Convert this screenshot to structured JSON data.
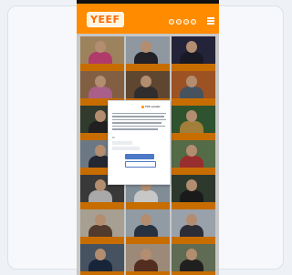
{
  "colors": {
    "brand": "#ff8c00",
    "brand_dark": "#ff6a00",
    "page_bg": "#eef1f6",
    "dialog_button_blue": "#4c79c6"
  },
  "header": {
    "logo_text": "YEEF",
    "icons": [
      "facebook-icon",
      "twitter-icon",
      "instagram-icon",
      "youtube-icon"
    ],
    "menu_icon": "hamburger-menu-icon"
  },
  "grid": {
    "tiles": [
      {
        "caption": "",
        "bg": "#c9a878",
        "shirt": "#e24c8a"
      },
      {
        "caption": "",
        "bg": "#b8c3cf",
        "shirt": "#2b2b33"
      },
      {
        "caption": "",
        "bg": "#2d2f4a",
        "shirt": "#1f2030"
      },
      {
        "caption": "",
        "bg": "#a77a55",
        "shirt": "#d97ab0"
      },
      {
        "caption": "",
        "bg": "#7a5a3e",
        "shirt": "#3d3a3a"
      },
      {
        "caption": "",
        "bg": "#c96a2e",
        "shirt": "#5a6b7a"
      },
      {
        "caption": "",
        "bg": "#3e4b3a",
        "shirt": "#2a2a2a"
      },
      {
        "caption": "",
        "bg": "#d8d2c8",
        "shirt": "#ffffff"
      },
      {
        "caption": "",
        "bg": "#3b6b3b",
        "shirt": "#cfa24a"
      },
      {
        "caption": "",
        "bg": "#8a9aa8",
        "shirt": "#2c3340"
      },
      {
        "caption": "",
        "bg": "#e9e6df",
        "shirt": "#444444"
      },
      {
        "caption": "",
        "bg": "#6b8a5a",
        "shirt": "#c43c3c"
      },
      {
        "caption": "",
        "bg": "#4a4a4a",
        "shirt": "#d9d9d9"
      },
      {
        "caption": "",
        "bg": "#a4b5c2",
        "shirt": "#ffffff"
      },
      {
        "caption": "",
        "bg": "#3a4a3a",
        "shirt": "#222222"
      },
      {
        "caption": "",
        "bg": "#d6ccbb",
        "shirt": "#6a4b3a"
      },
      {
        "caption": "",
        "bg": "#b9c7d3",
        "shirt": "#333f52"
      },
      {
        "caption": "",
        "bg": "#c5d0da",
        "shirt": "#3a3a48"
      },
      {
        "caption": "",
        "bg": "#5a6a7a",
        "shirt": "#1f2f4a"
      },
      {
        "caption": "",
        "bg": "#c8b09a",
        "shirt": "#6a3a2a"
      },
      {
        "caption": "",
        "bg": "#7a8a6a",
        "shirt": "#2a2a2a"
      }
    ]
  },
  "dialog": {
    "brand": "TCF vendor",
    "footer_links": [
      "",
      "",
      ""
    ],
    "settings_link": "",
    "accept_label": "",
    "reject_label": ""
  }
}
